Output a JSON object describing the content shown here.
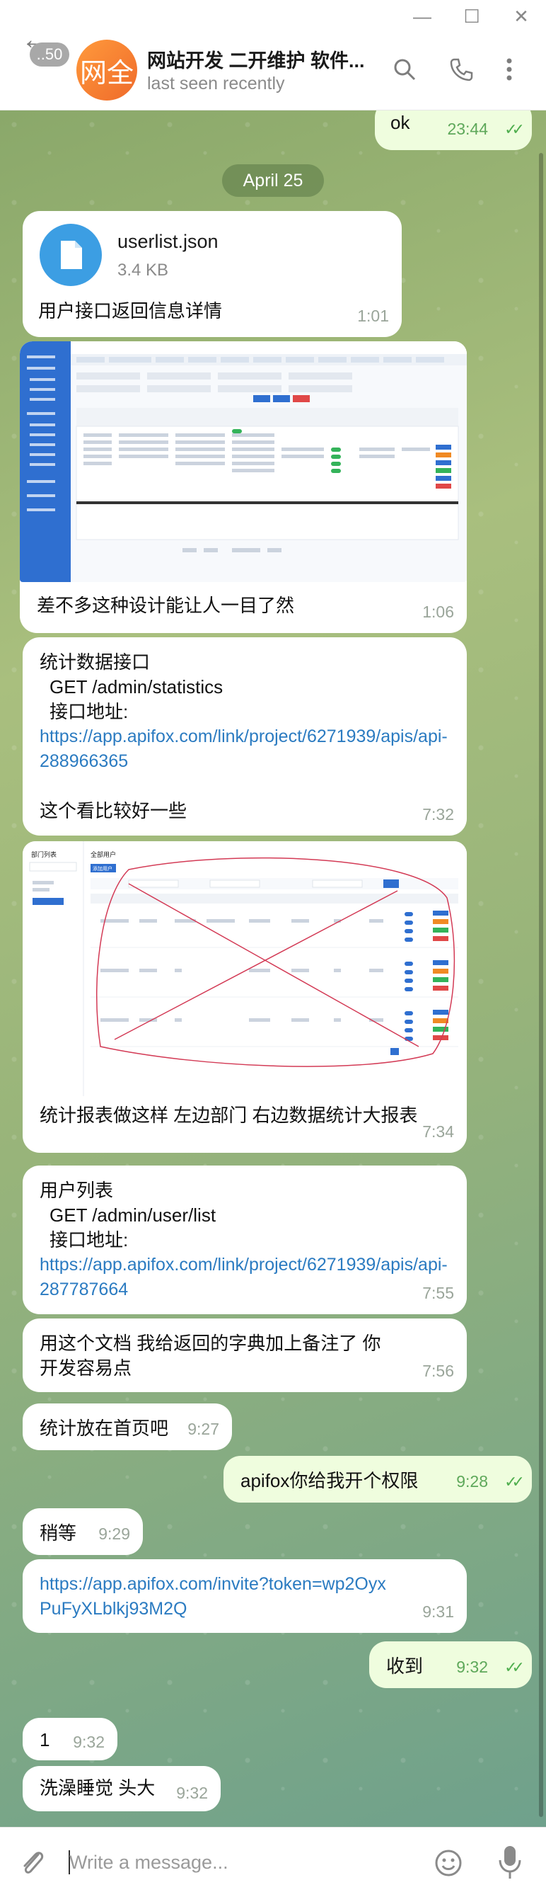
{
  "window": {
    "minimize": "—",
    "maximize": "☐",
    "close": "✕"
  },
  "header": {
    "unread_count": "..50",
    "avatar_text": "网全",
    "title": "网站开发 二开维护 软件...",
    "status": "last seen recently"
  },
  "messages": {
    "m0": {
      "text": "ok",
      "time": "23:44"
    },
    "date": "April 25",
    "file": {
      "name": "userlist.json",
      "size": "3.4 KB",
      "caption": "用户接口返回信息详情",
      "time": "1:01"
    },
    "img1": {
      "caption": "差不多这种设计能让人一目了然",
      "time": "1:06"
    },
    "stats": {
      "line1": "统计数据接口",
      "line2": "GET /admin/statistics",
      "line3": "接口地址:",
      "link": "https://app.apifox.com/link/project/6271939/apis/api-288966365",
      "line4": "这个看比较好一些",
      "time": "7:32"
    },
    "img2": {
      "caption": "统计报表做这样 左边部门 右边数据统计大报表",
      "time": "7:34",
      "left_title": "部门列表",
      "right_title": "全部用户",
      "button": "添加用户"
    },
    "userlist": {
      "line1": "用户列表",
      "line2": "GET /admin/user/list",
      "line3": "接口地址:",
      "link": "https://app.apifox.com/link/project/6271939/apis/api-287787664",
      "time": "7:55"
    },
    "m_doc": {
      "text": "用这个文档 我给返回的字典加上备注了 你开发容易点",
      "time": "7:56"
    },
    "m_home": {
      "text": "统计放在首页吧",
      "time": "9:27"
    },
    "m_perm": {
      "text": "apifox你给我开个权限",
      "time": "9:28"
    },
    "m_wait": {
      "text": "稍等",
      "time": "9:29"
    },
    "m_invite": {
      "link": "https://app.apifox.com/invite?token=wp2OyxPuFyXLblkj93M2Q",
      "time": "9:31"
    },
    "m_recv": {
      "text": "收到",
      "time": "9:32"
    },
    "m_one": {
      "text": "1",
      "time": "9:32"
    },
    "m_bath": {
      "text": "洗澡睡觉 头大",
      "time": "9:32"
    }
  },
  "input": {
    "placeholder": "Write a message..."
  },
  "colors": {
    "incoming": "#ffffff",
    "outgoing": "#effdde",
    "link": "#2b7bc1",
    "avatar": "#f07a2e"
  }
}
